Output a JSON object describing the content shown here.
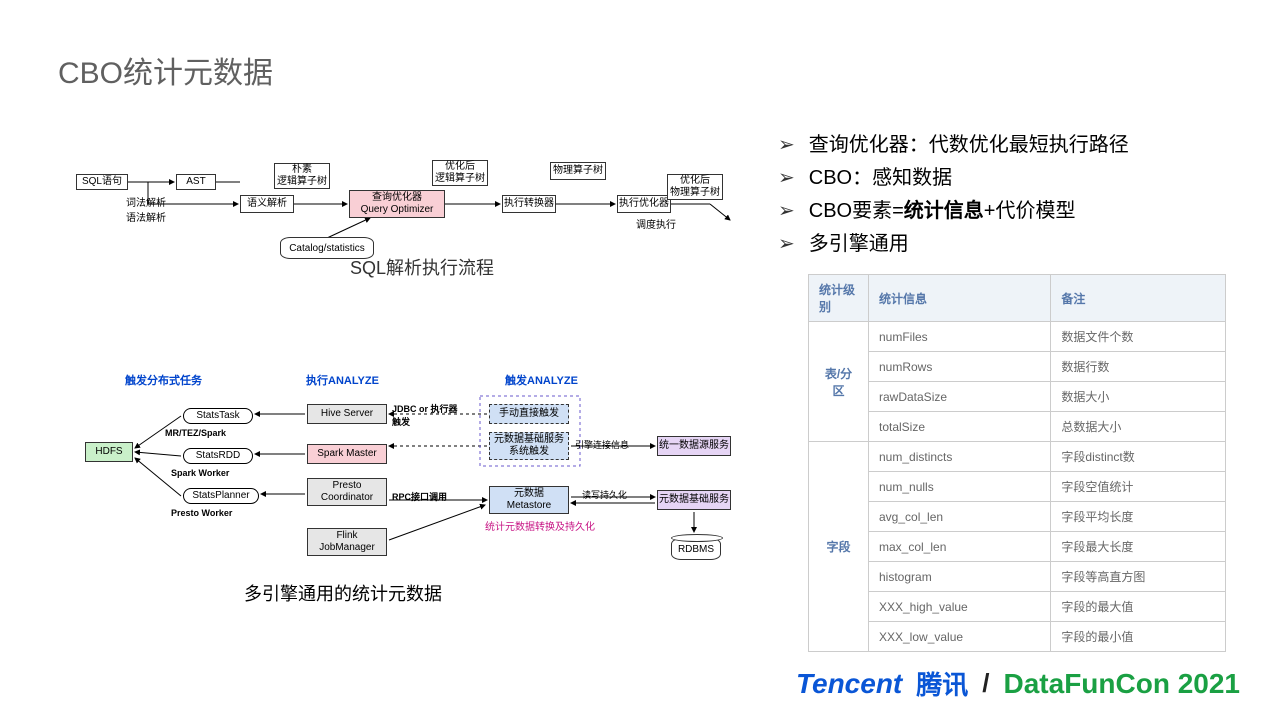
{
  "title": "CBO统计元数据",
  "diag1": {
    "sql": "SQL语句",
    "ast": "AST",
    "sem": "语义解析",
    "tree": "朴素\n逻辑算子树",
    "qopt": "查询优化器\nQuery Optimizer",
    "otree": "优化后\n逻辑算子树",
    "exec": "执行转换器",
    "ptree": "物理算子树",
    "eopt": "执行优化器",
    "optree": "优化后\n物理算子树",
    "cat": "Catalog/statistics",
    "l1": "词法解析\n语法解析",
    "l2": "调度执行",
    "caption": "SQL解析执行流程"
  },
  "diag2": {
    "h1": "触发分布式任务",
    "h2": "执行ANALYZE",
    "h3": "触发ANALYZE",
    "hdfs": "HDFS",
    "st1": "StatsTask",
    "st2": "StatsRDD",
    "st3": "StatsPlanner",
    "hive": "Hive Server",
    "spark": "Spark Master",
    "presto": "Presto\nCoordinator",
    "flink": "Flink\nJobManager",
    "man": "手动直接触发",
    "meta": "元数据基础服务\n系统触发",
    "unif": "统一数据源服务",
    "ms": "元数据\nMetastore",
    "mbase": "元数据基础服务",
    "rdbms": "RDBMS",
    "mr": "MR/TEZ/Spark",
    "sw": "Spark Worker",
    "pw": "Presto Worker",
    "jd": "JDBC or 执行器\n触发",
    "rp": "RPC接口调用",
    "eng": "引擎连接信息",
    "rw": "读写持久化",
    "persist": "统计元数据转换及持久化",
    "caption": "多引擎通用的统计元数据"
  },
  "bullets": [
    {
      "text": "查询优化器：代数优化最短执行路径"
    },
    {
      "text": "CBO：感知数据"
    },
    {
      "html": "CBO要素=<strong>统计信息</strong>+代价模型"
    },
    {
      "text": "多引擎通用"
    }
  ],
  "table": {
    "headers": [
      "统计级别",
      "统计信息",
      "备注"
    ],
    "groups": [
      {
        "level": "表/分区",
        "rows": [
          [
            "numFiles",
            "数据文件个数"
          ],
          [
            "numRows",
            "数据行数"
          ],
          [
            "rawDataSize",
            "数据大小"
          ],
          [
            "totalSize",
            "总数据大小"
          ]
        ]
      },
      {
        "level": "字段",
        "rows": [
          [
            "num_distincts",
            "字段distinct数"
          ],
          [
            "num_nulls",
            "字段空值统计"
          ],
          [
            "avg_col_len",
            "字段平均长度"
          ],
          [
            "max_col_len",
            "字段最大长度"
          ],
          [
            "histogram",
            "字段等高直方图"
          ],
          [
            "XXX_high_value",
            "字段的最大值"
          ],
          [
            "XXX_low_value",
            "字段的最小值"
          ]
        ]
      }
    ]
  },
  "footer": {
    "tencent": "Tencent",
    "tencent_cn": "腾讯",
    "slash": "/",
    "dfc": "DataFunCon 2021"
  }
}
